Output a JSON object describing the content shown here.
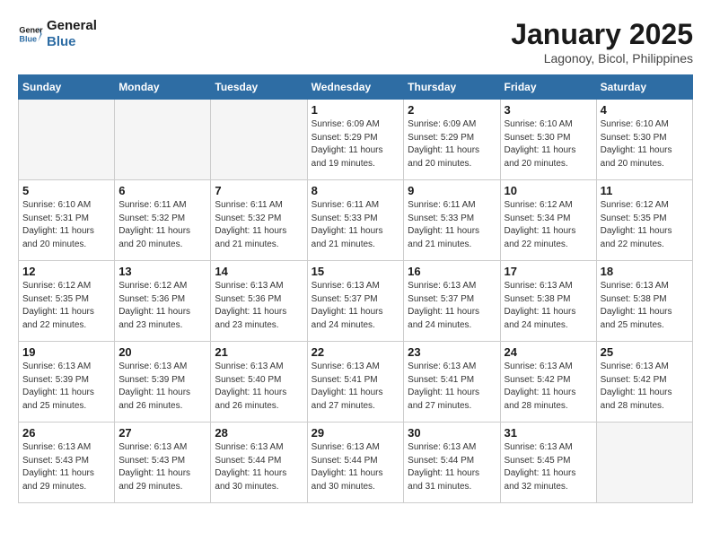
{
  "logo": {
    "line1": "General",
    "line2": "Blue"
  },
  "title": "January 2025",
  "subtitle": "Lagonoy, Bicol, Philippines",
  "weekdays": [
    "Sunday",
    "Monday",
    "Tuesday",
    "Wednesday",
    "Thursday",
    "Friday",
    "Saturday"
  ],
  "weeks": [
    [
      {
        "day": "",
        "info": ""
      },
      {
        "day": "",
        "info": ""
      },
      {
        "day": "",
        "info": ""
      },
      {
        "day": "1",
        "info": "Sunrise: 6:09 AM\nSunset: 5:29 PM\nDaylight: 11 hours\nand 19 minutes."
      },
      {
        "day": "2",
        "info": "Sunrise: 6:09 AM\nSunset: 5:29 PM\nDaylight: 11 hours\nand 20 minutes."
      },
      {
        "day": "3",
        "info": "Sunrise: 6:10 AM\nSunset: 5:30 PM\nDaylight: 11 hours\nand 20 minutes."
      },
      {
        "day": "4",
        "info": "Sunrise: 6:10 AM\nSunset: 5:30 PM\nDaylight: 11 hours\nand 20 minutes."
      }
    ],
    [
      {
        "day": "5",
        "info": "Sunrise: 6:10 AM\nSunset: 5:31 PM\nDaylight: 11 hours\nand 20 minutes."
      },
      {
        "day": "6",
        "info": "Sunrise: 6:11 AM\nSunset: 5:32 PM\nDaylight: 11 hours\nand 20 minutes."
      },
      {
        "day": "7",
        "info": "Sunrise: 6:11 AM\nSunset: 5:32 PM\nDaylight: 11 hours\nand 21 minutes."
      },
      {
        "day": "8",
        "info": "Sunrise: 6:11 AM\nSunset: 5:33 PM\nDaylight: 11 hours\nand 21 minutes."
      },
      {
        "day": "9",
        "info": "Sunrise: 6:11 AM\nSunset: 5:33 PM\nDaylight: 11 hours\nand 21 minutes."
      },
      {
        "day": "10",
        "info": "Sunrise: 6:12 AM\nSunset: 5:34 PM\nDaylight: 11 hours\nand 22 minutes."
      },
      {
        "day": "11",
        "info": "Sunrise: 6:12 AM\nSunset: 5:35 PM\nDaylight: 11 hours\nand 22 minutes."
      }
    ],
    [
      {
        "day": "12",
        "info": "Sunrise: 6:12 AM\nSunset: 5:35 PM\nDaylight: 11 hours\nand 22 minutes."
      },
      {
        "day": "13",
        "info": "Sunrise: 6:12 AM\nSunset: 5:36 PM\nDaylight: 11 hours\nand 23 minutes."
      },
      {
        "day": "14",
        "info": "Sunrise: 6:13 AM\nSunset: 5:36 PM\nDaylight: 11 hours\nand 23 minutes."
      },
      {
        "day": "15",
        "info": "Sunrise: 6:13 AM\nSunset: 5:37 PM\nDaylight: 11 hours\nand 24 minutes."
      },
      {
        "day": "16",
        "info": "Sunrise: 6:13 AM\nSunset: 5:37 PM\nDaylight: 11 hours\nand 24 minutes."
      },
      {
        "day": "17",
        "info": "Sunrise: 6:13 AM\nSunset: 5:38 PM\nDaylight: 11 hours\nand 24 minutes."
      },
      {
        "day": "18",
        "info": "Sunrise: 6:13 AM\nSunset: 5:38 PM\nDaylight: 11 hours\nand 25 minutes."
      }
    ],
    [
      {
        "day": "19",
        "info": "Sunrise: 6:13 AM\nSunset: 5:39 PM\nDaylight: 11 hours\nand 25 minutes."
      },
      {
        "day": "20",
        "info": "Sunrise: 6:13 AM\nSunset: 5:39 PM\nDaylight: 11 hours\nand 26 minutes."
      },
      {
        "day": "21",
        "info": "Sunrise: 6:13 AM\nSunset: 5:40 PM\nDaylight: 11 hours\nand 26 minutes."
      },
      {
        "day": "22",
        "info": "Sunrise: 6:13 AM\nSunset: 5:41 PM\nDaylight: 11 hours\nand 27 minutes."
      },
      {
        "day": "23",
        "info": "Sunrise: 6:13 AM\nSunset: 5:41 PM\nDaylight: 11 hours\nand 27 minutes."
      },
      {
        "day": "24",
        "info": "Sunrise: 6:13 AM\nSunset: 5:42 PM\nDaylight: 11 hours\nand 28 minutes."
      },
      {
        "day": "25",
        "info": "Sunrise: 6:13 AM\nSunset: 5:42 PM\nDaylight: 11 hours\nand 28 minutes."
      }
    ],
    [
      {
        "day": "26",
        "info": "Sunrise: 6:13 AM\nSunset: 5:43 PM\nDaylight: 11 hours\nand 29 minutes."
      },
      {
        "day": "27",
        "info": "Sunrise: 6:13 AM\nSunset: 5:43 PM\nDaylight: 11 hours\nand 29 minutes."
      },
      {
        "day": "28",
        "info": "Sunrise: 6:13 AM\nSunset: 5:44 PM\nDaylight: 11 hours\nand 30 minutes."
      },
      {
        "day": "29",
        "info": "Sunrise: 6:13 AM\nSunset: 5:44 PM\nDaylight: 11 hours\nand 30 minutes."
      },
      {
        "day": "30",
        "info": "Sunrise: 6:13 AM\nSunset: 5:44 PM\nDaylight: 11 hours\nand 31 minutes."
      },
      {
        "day": "31",
        "info": "Sunrise: 6:13 AM\nSunset: 5:45 PM\nDaylight: 11 hours\nand 32 minutes."
      },
      {
        "day": "",
        "info": ""
      }
    ]
  ]
}
